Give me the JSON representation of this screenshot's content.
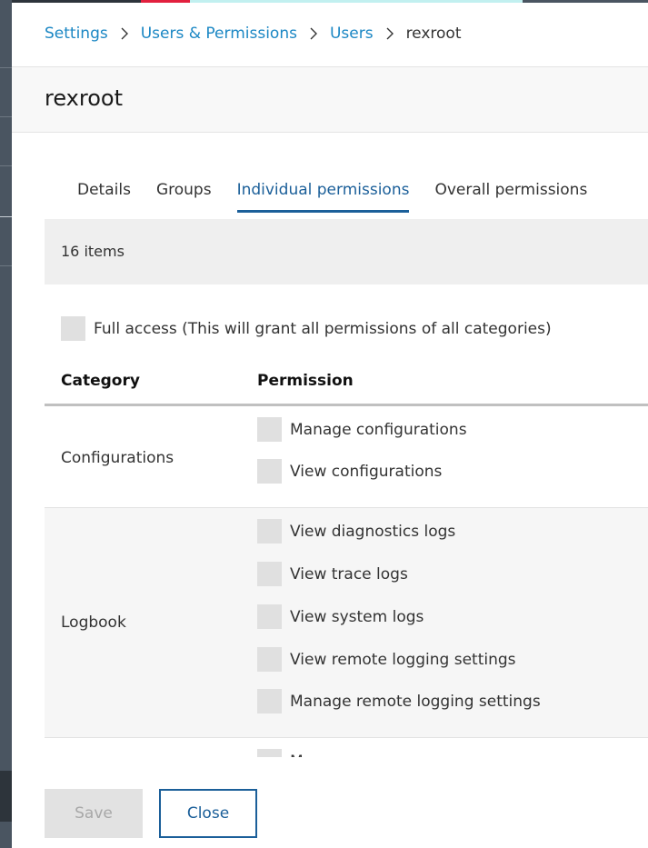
{
  "top_bar_colors": [
    "#2d343b",
    "#e2203e",
    "#c2f0f0",
    "#4a5561"
  ],
  "breadcrumb": {
    "items": [
      "Settings",
      "Users & Permissions",
      "Users"
    ],
    "current": "rexroot",
    "separator": ">"
  },
  "page_title": "rexroot",
  "tabs": [
    {
      "label": "Details",
      "active": false
    },
    {
      "label": "Groups",
      "active": false
    },
    {
      "label": "Individual permissions",
      "active": true
    },
    {
      "label": "Overall permissions",
      "active": false
    }
  ],
  "items_count": "16 items",
  "full_access_label": "Full access (This will grant all permissions of all categories)",
  "table": {
    "headers": {
      "category": "Category",
      "permission": "Permission"
    },
    "rows": [
      {
        "category": "Configurations",
        "permissions": [
          "Manage configurations",
          "View configurations"
        ]
      },
      {
        "category": "Logbook",
        "permissions": [
          "View diagnostics logs",
          "View trace logs",
          "View system logs",
          "View remote logging settings",
          "Manage remote logging settings"
        ]
      },
      {
        "category": "",
        "permissions": [
          "M"
        ]
      }
    ]
  },
  "buttons": {
    "save": "Save",
    "close": "Close"
  },
  "colors": {
    "link": "#1b87c4",
    "accent": "#1b5f99",
    "checkbox": "#e0e0e0"
  }
}
